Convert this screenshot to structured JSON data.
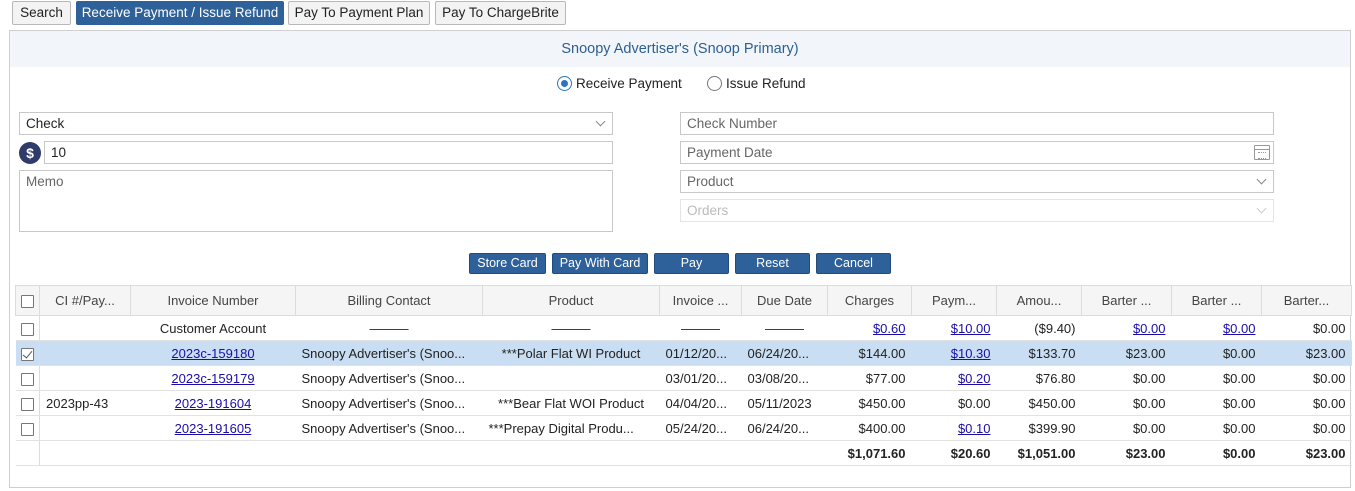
{
  "tabs": [
    {
      "label": "Search"
    },
    {
      "label": "Receive Payment / Issue Refund"
    },
    {
      "label": "Pay To Payment Plan"
    },
    {
      "label": "Pay To ChargeBrite"
    }
  ],
  "panel": {
    "title": "Snoopy Advertiser's (Snoop Primary)",
    "radio_receive": "Receive Payment",
    "radio_refund": "Issue Refund",
    "method_value": "Check",
    "currency_symbol": "$",
    "amount_value": "10",
    "memo_placeholder": "Memo",
    "check_number_placeholder": "Check Number",
    "payment_date_placeholder": "Payment Date",
    "product_placeholder": "Product",
    "orders_placeholder": "Orders"
  },
  "buttons": {
    "store_card": "Store Card",
    "pay_with_card": "Pay With Card",
    "pay": "Pay",
    "reset": "Reset",
    "cancel": "Cancel"
  },
  "table": {
    "headers": [
      "CI #/Pay...",
      "Invoice Number",
      "Billing Contact",
      "Product",
      "Invoice ...",
      "Due Date",
      "Charges",
      "Paym...",
      "Amou...",
      "Barter ...",
      "Barter ...",
      "Barter..."
    ],
    "rows": [
      {
        "ci": "",
        "invoice": "Customer Account",
        "contact": "———",
        "product": "———",
        "invoice_date": "———",
        "due": "———",
        "charges": "$0.60",
        "payments": "$10.00",
        "amount": "($9.40)",
        "b1": "$0.00",
        "b2": "$0.00",
        "b3": "$0.00"
      },
      {
        "ci": "",
        "invoice": "2023c-159180",
        "contact": "Snoopy Advertiser's (Snoo...",
        "product": "***Polar Flat WI Product",
        "invoice_date": "01/12/20...",
        "due": "06/24/20...",
        "charges": "$144.00",
        "payments": "$10.30",
        "amount": "$133.70",
        "b1": "$23.00",
        "b2": "$0.00",
        "b3": "$23.00"
      },
      {
        "ci": "",
        "invoice": "2023c-159179",
        "contact": "Snoopy Advertiser's (Snoo...",
        "product": "",
        "invoice_date": "03/01/20...",
        "due": "03/08/20...",
        "charges": "$77.00",
        "payments": "$0.20",
        "amount": "$76.80",
        "b1": "$0.00",
        "b2": "$0.00",
        "b3": "$0.00"
      },
      {
        "ci": "2023pp-43",
        "invoice": "2023-191604",
        "contact": "Snoopy Advertiser's (Snoo...",
        "product": "***Bear Flat WOI Product",
        "invoice_date": "04/04/20...",
        "due": "05/11/2023",
        "charges": "$450.00",
        "payments": "$0.00",
        "amount": "$450.00",
        "b1": "$0.00",
        "b2": "$0.00",
        "b3": "$0.00"
      },
      {
        "ci": "",
        "invoice": "2023-191605",
        "contact": "Snoopy Advertiser's (Snoo...",
        "product": "***Prepay Digital Produ...",
        "invoice_date": "05/24/20...",
        "due": "06/24/20...",
        "charges": "$400.00",
        "payments": "$0.10",
        "amount": "$399.90",
        "b1": "$0.00",
        "b2": "$0.00",
        "b3": "$0.00"
      }
    ],
    "totals": {
      "charges": "$1,071.60",
      "payments": "$20.60",
      "amount": "$1,051.00",
      "b1": "$23.00",
      "b2": "$0.00",
      "b3": "$23.00"
    }
  }
}
